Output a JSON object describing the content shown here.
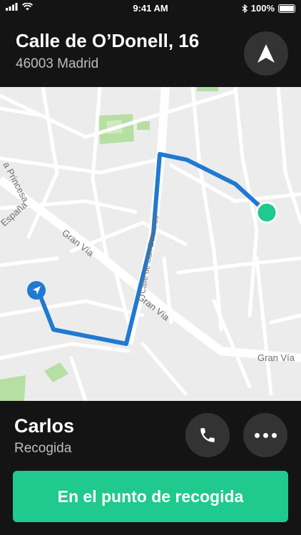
{
  "status_bar": {
    "time": "9:41 AM",
    "battery": "100%"
  },
  "header": {
    "street": "Calle de O’Donell, 16",
    "city": "46003 Madrid",
    "nav_icon": "navigation-arrow-icon"
  },
  "map": {
    "labels": {
      "princesa": "a Princesa",
      "espana": "España",
      "gran_via_1": "Gran Vía",
      "gran_via_2": "Gran Vía",
      "gran_via_3": "Gran Vía",
      "san_bernardo": "Calle de San Bernardo"
    },
    "route_color": "#1f7ad1",
    "destination_color": "#20c98e"
  },
  "driver": {
    "name": "Carlos",
    "status": "Recogida"
  },
  "actions": {
    "call_icon": "phone-icon",
    "more_icon": "more-dots-icon",
    "primary_label": "En el punto de recogida"
  },
  "colors": {
    "accent": "#20c98e",
    "background": "#141414",
    "button_gray": "#333333"
  }
}
